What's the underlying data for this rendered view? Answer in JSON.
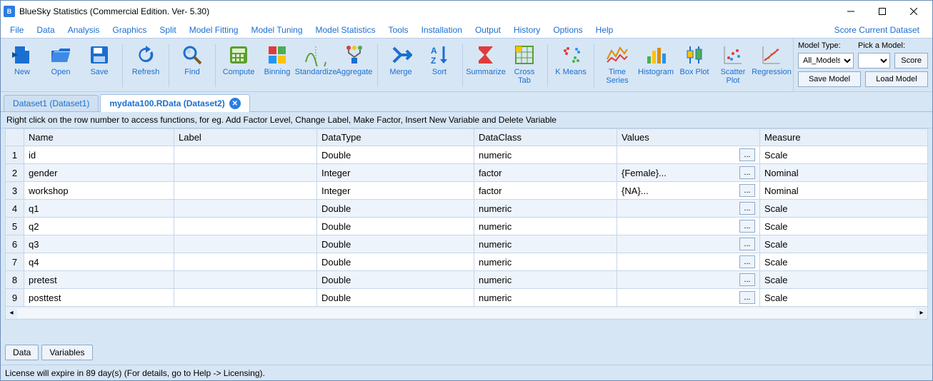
{
  "title": "BlueSky Statistics (Commercial Edition. Ver- 5.30)",
  "menu": [
    "File",
    "Data",
    "Analysis",
    "Graphics",
    "Split",
    "Model Fitting",
    "Model Tuning",
    "Model Statistics",
    "Tools",
    "Installation",
    "Output",
    "History",
    "Options",
    "Help"
  ],
  "score_link": "Score Current Dataset",
  "side": {
    "model_type_label": "Model Type:",
    "pick_model_label": "Pick a Model:",
    "model_type_value": "All_Models",
    "score_btn": "Score",
    "save_model": "Save Model",
    "load_model": "Load Model"
  },
  "toolbar": [
    {
      "key": "new",
      "label": "New"
    },
    {
      "key": "open",
      "label": "Open"
    },
    {
      "key": "save",
      "label": "Save"
    },
    {
      "sep": true
    },
    {
      "key": "refresh",
      "label": "Refresh"
    },
    {
      "sep": true
    },
    {
      "key": "find",
      "label": "Find"
    },
    {
      "sep": true
    },
    {
      "key": "compute",
      "label": "Compute"
    },
    {
      "key": "binning",
      "label": "Binning"
    },
    {
      "key": "standardize",
      "label": "Standardize"
    },
    {
      "key": "aggregate",
      "label": "Aggregate"
    },
    {
      "sep": true
    },
    {
      "key": "merge",
      "label": "Merge"
    },
    {
      "key": "sort",
      "label": "Sort"
    },
    {
      "sep": true
    },
    {
      "key": "summarize",
      "label": "Summarize"
    },
    {
      "key": "crosstab",
      "label": "Cross Tab"
    },
    {
      "sep": true
    },
    {
      "key": "kmeans",
      "label": "K Means"
    },
    {
      "sep": true
    },
    {
      "key": "timeseries",
      "label": "Time Series"
    },
    {
      "key": "histogram",
      "label": "Histogram"
    },
    {
      "key": "boxplot",
      "label": "Box Plot"
    },
    {
      "key": "scatter",
      "label": "Scatter Plot"
    },
    {
      "key": "regression",
      "label": "Regression"
    }
  ],
  "tabs": [
    {
      "label": "Dataset1 (Dataset1)",
      "active": false,
      "closable": false
    },
    {
      "label": "mydata100.RData (Dataset2)",
      "active": true,
      "closable": true
    }
  ],
  "hint": "Right click on the row number to access functions, for eg. Add Factor Level, Change Label, Make Factor, Insert New Variable and Delete Variable",
  "columns": [
    "Name",
    "Label",
    "DataType",
    "DataClass",
    "Values",
    "Measure"
  ],
  "rows": [
    {
      "n": 1,
      "name": "id",
      "label": "",
      "dtype": "Double",
      "dclass": "numeric",
      "values": "",
      "measure": "Scale"
    },
    {
      "n": 2,
      "name": "gender",
      "label": "",
      "dtype": "Integer",
      "dclass": "factor",
      "values": "{Female}...",
      "measure": "Nominal"
    },
    {
      "n": 3,
      "name": "workshop",
      "label": "",
      "dtype": "Integer",
      "dclass": "factor",
      "values": "{NA}...",
      "measure": "Nominal"
    },
    {
      "n": 4,
      "name": "q1",
      "label": "",
      "dtype": "Double",
      "dclass": "numeric",
      "values": "",
      "measure": "Scale"
    },
    {
      "n": 5,
      "name": "q2",
      "label": "",
      "dtype": "Double",
      "dclass": "numeric",
      "values": "",
      "measure": "Scale"
    },
    {
      "n": 6,
      "name": "q3",
      "label": "",
      "dtype": "Double",
      "dclass": "numeric",
      "values": "",
      "measure": "Scale"
    },
    {
      "n": 7,
      "name": "q4",
      "label": "",
      "dtype": "Double",
      "dclass": "numeric",
      "values": "",
      "measure": "Scale"
    },
    {
      "n": 8,
      "name": "pretest",
      "label": "",
      "dtype": "Double",
      "dclass": "numeric",
      "values": "",
      "measure": "Scale"
    },
    {
      "n": 9,
      "name": "posttest",
      "label": "",
      "dtype": "Double",
      "dclass": "numeric",
      "values": "",
      "measure": "Scale"
    }
  ],
  "bottom_tabs": {
    "data": "Data",
    "variables": "Variables"
  },
  "status": "License will expire in 89 day(s) (For details, go to Help -> Licensing).",
  "values_btn": "..."
}
